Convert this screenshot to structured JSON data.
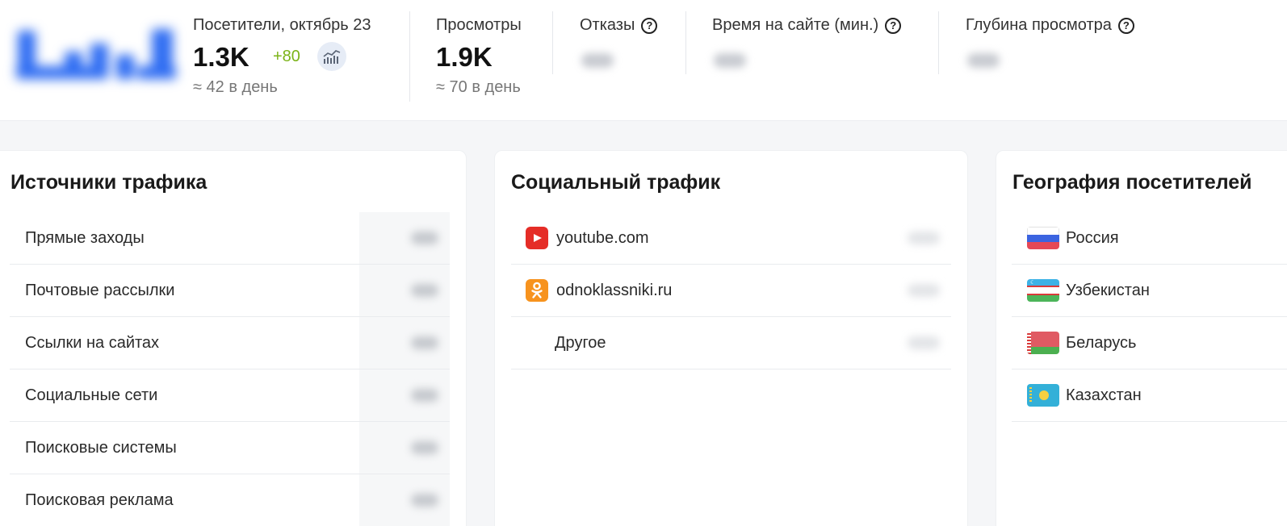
{
  "header": {
    "visitors": {
      "label": "Посетители, октябрь 23",
      "value": "1.3K",
      "delta": "+80",
      "per_day": "≈ 42 в день"
    },
    "views": {
      "label": "Просмотры",
      "value": "1.9K",
      "per_day": "≈ 70 в день"
    },
    "bounces": {
      "label": "Отказы"
    },
    "time_on_site": {
      "label": "Время на сайте (мин.)"
    },
    "depth": {
      "label": "Глубина просмотра"
    }
  },
  "traffic_sources": {
    "title": "Источники трафика",
    "items": [
      {
        "label": "Прямые заходы"
      },
      {
        "label": "Почтовые рассылки"
      },
      {
        "label": "Ссылки на сайтах"
      },
      {
        "label": "Социальные сети"
      },
      {
        "label": "Поисковые системы"
      },
      {
        "label": "Поисковая реклама"
      }
    ]
  },
  "social_traffic": {
    "title": "Социальный трафик",
    "items": [
      {
        "label": "youtube.com",
        "icon": "youtube-icon",
        "color": "#e52d27"
      },
      {
        "label": "odnoklassniki.ru",
        "icon": "odnoklassniki-icon",
        "color": "#f7931e"
      },
      {
        "label": "Другое"
      }
    ]
  },
  "geography": {
    "title": "География посетителей",
    "items": [
      {
        "label": "Россия",
        "icon": "flag-russia-icon"
      },
      {
        "label": "Узбекистан",
        "icon": "flag-uzbekistan-icon"
      },
      {
        "label": "Беларусь",
        "icon": "flag-belarus-icon"
      },
      {
        "label": "Казахстан",
        "icon": "flag-kazakhstan-icon"
      }
    ]
  },
  "colors": {
    "accent_green": "#7bb317",
    "logo_blue": "#2f6df2"
  }
}
